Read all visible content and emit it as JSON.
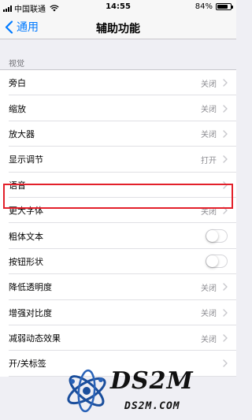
{
  "status_bar": {
    "carrier": "中国联通",
    "time": "14:55",
    "battery_percent": "84%",
    "battery_level": 0.84
  },
  "nav": {
    "back_label": "通用",
    "title": "辅助功能"
  },
  "section_header": "视觉",
  "rows": [
    {
      "label": "旁白",
      "value": "关闭",
      "type": "link"
    },
    {
      "label": "缩放",
      "value": "关闭",
      "type": "link"
    },
    {
      "label": "放大器",
      "value": "关闭",
      "type": "link"
    },
    {
      "label": "显示调节",
      "value": "打开",
      "type": "link"
    },
    {
      "label": "语音",
      "value": "",
      "type": "link",
      "highlighted": true
    },
    {
      "label": "更大字体",
      "value": "关闭",
      "type": "link"
    },
    {
      "label": "粗体文本",
      "value": "",
      "type": "toggle",
      "on": false
    },
    {
      "label": "按钮形状",
      "value": "",
      "type": "toggle",
      "on": false
    },
    {
      "label": "降低透明度",
      "value": "关闭",
      "type": "link"
    },
    {
      "label": "增强对比度",
      "value": "关闭",
      "type": "link"
    },
    {
      "label": "减弱动态效果",
      "value": "关闭",
      "type": "link"
    },
    {
      "label": "开/关标签",
      "value": "",
      "type": "link"
    }
  ],
  "watermark": {
    "title": "DS2M",
    "subtitle": "DS2M.COM"
  },
  "colors": {
    "accent": "#007aff",
    "highlight": "#e3202a",
    "background": "#efeff4",
    "secondary_text": "#8e8e93"
  }
}
